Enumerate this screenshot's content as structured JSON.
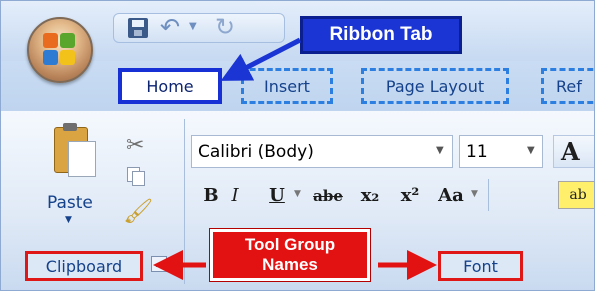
{
  "window": {
    "office_button_icon": "office-logo-icon",
    "quick_access": [
      "save-icon",
      "undo-icon",
      "redo-icon"
    ]
  },
  "tabs": [
    {
      "label": "Home",
      "active": true
    },
    {
      "label": "Insert",
      "active": false
    },
    {
      "label": "Page Layout",
      "active": false
    },
    {
      "label": "Ref",
      "active": false
    }
  ],
  "clipboard_group": {
    "paste_label": "Paste",
    "icons": [
      "paste-icon",
      "cut-icon",
      "copy-icon",
      "format-painter-icon"
    ],
    "group_name": "Clipboard"
  },
  "font_group": {
    "font_name": "Calibri (Body)",
    "font_size": "11",
    "grow_font_glyph": "A",
    "format_buttons": {
      "bold": "B",
      "italic": "I",
      "underline": "U",
      "strikethrough": "abe",
      "subscript": "x₂",
      "superscript": "x²",
      "change_case": "Aa",
      "highlight": "ab"
    },
    "group_name": "Font"
  },
  "callouts": {
    "ribbon_tab": "Ribbon Tab",
    "tool_group_names_line1": "Tool Group",
    "tool_group_names_line2": "Names"
  },
  "colors": {
    "ribbon_tab_callout": "#1a35d4",
    "group_name_callout": "#e31212",
    "active_tab_border": "#1630d6",
    "inactive_tab_border": "#2c7fe0"
  }
}
